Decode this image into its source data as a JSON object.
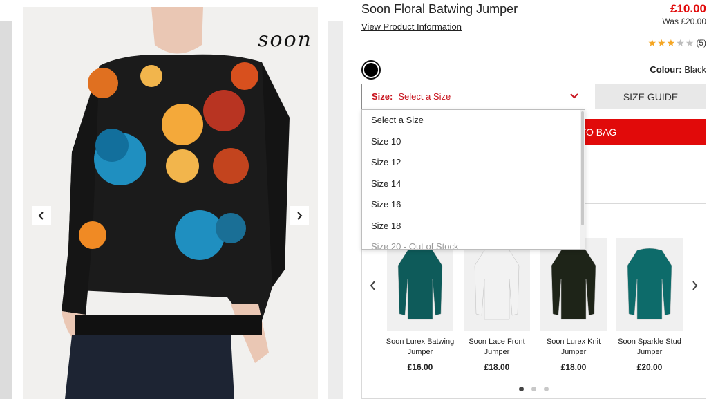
{
  "product": {
    "title": "Soon Floral Batwing Jumper",
    "view_info_link": "View Product Information",
    "price": "£10.00",
    "was_price": "Was £20.00",
    "rating": 3,
    "rating_max": 5,
    "rating_count": "(5)",
    "colour_label": "Colour:",
    "colour_value": "Black",
    "swatch_color": "#000000",
    "brand_logo": "soon"
  },
  "size": {
    "label": "Size:",
    "selected": "Select a Size",
    "options": [
      "Select a Size",
      "Size 10",
      "Size 12",
      "Size 14",
      "Size 16",
      "Size 18",
      "Size 20 - Out of Stock"
    ],
    "size_guide": "SIZE GUIDE",
    "add_to_bag": "TO BAG"
  },
  "recommendations": {
    "items": [
      {
        "name": "Soon Lurex Batwing Jumper",
        "price": "£16.00",
        "color": "#0e5b5a"
      },
      {
        "name": "Soon Lace Front Jumper",
        "price": "£18.00",
        "color": "#f2f2f2"
      },
      {
        "name": "Soon Lurex Knit Jumper",
        "price": "£18.00",
        "color": "#1e2418"
      },
      {
        "name": "Soon Sparkle Stud Jumper",
        "price": "£20.00",
        "color": "#0d6b6a"
      }
    ],
    "page_count": 3,
    "active_page": 1
  },
  "colors": {
    "accent_red": "#e10a0a",
    "size_red": "#c8141e",
    "star": "#f5a623"
  },
  "icons": {
    "gallery_prev": "chevron-left-icon",
    "gallery_next": "chevron-right-icon",
    "select_chevron": "chevron-down-icon",
    "star": "star-icon"
  }
}
